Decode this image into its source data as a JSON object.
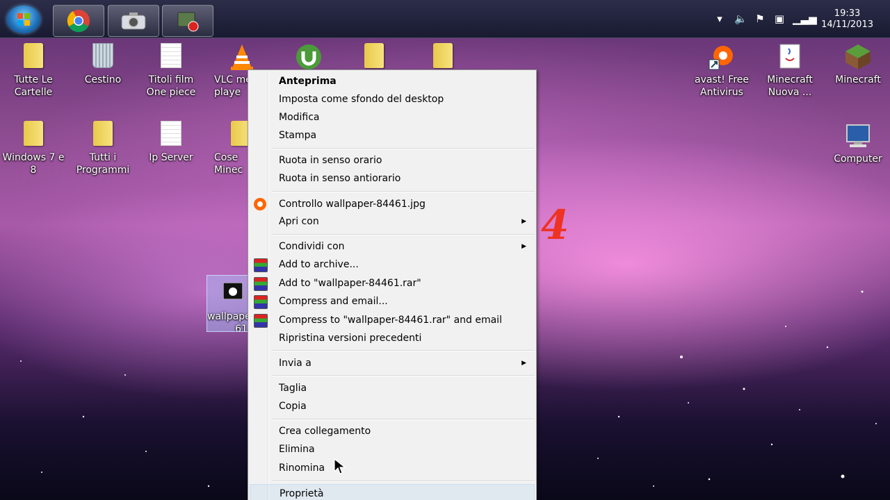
{
  "taskbar": {
    "buttons": [
      "chrome-icon",
      "camera-icon",
      "recorder-icon"
    ],
    "clock": {
      "time": "19:33",
      "date": "14/11/2013"
    }
  },
  "desktop": {
    "icons_left": [
      {
        "label": "Tutte Le Cartelle",
        "icon": "folder-icon"
      },
      {
        "label": "Cestino",
        "icon": "recycle-bin-icon"
      },
      {
        "label": "Titoli film One piece",
        "icon": "document-icon"
      },
      {
        "label": "VLC me playe",
        "icon": "vlc-icon"
      },
      {
        "label": "",
        "icon": "utorrent-icon"
      },
      {
        "label": "",
        "icon": "folder-icon"
      },
      {
        "label": "",
        "icon": "folder-icon"
      },
      {
        "label": "Windows 7 e 8",
        "icon": "folder-icon"
      },
      {
        "label": "Tutti i Programmi",
        "icon": "folder-icon"
      },
      {
        "label": "Ip Server",
        "icon": "document-icon"
      },
      {
        "label": "Cose Minec",
        "icon": "folder-icon"
      }
    ],
    "icons_right": [
      {
        "label": "avast! Free Antivirus",
        "icon": "avast-icon"
      },
      {
        "label": "Minecraft Nuova ...",
        "icon": "java-icon"
      },
      {
        "label": "Minecraft",
        "icon": "minecraft-icon"
      },
      {
        "label": "Computer",
        "icon": "computer-icon"
      }
    ],
    "selected_file": {
      "label_line1": "wallpape",
      "label_line2": "61",
      "icon": "apple-image-icon"
    }
  },
  "context_menu": {
    "items": [
      {
        "label": "Anteprima",
        "bold": true
      },
      {
        "label": "Imposta come sfondo del desktop"
      },
      {
        "label": "Modifica"
      },
      {
        "label": "Stampa"
      },
      {
        "label": "Ruota in senso orario"
      },
      {
        "label": "Ruota in senso antiorario"
      },
      {
        "label": "Controllo wallpaper-84461.jpg",
        "icon": "avast-icon"
      },
      {
        "label": "Apri con",
        "submenu": true
      },
      {
        "label": "Condividi con",
        "submenu": true
      },
      {
        "label": "Add to archive...",
        "icon": "winrar-icon"
      },
      {
        "label": "Add to \"wallpaper-84461.rar\"",
        "icon": "winrar-icon"
      },
      {
        "label": "Compress and email...",
        "icon": "winrar-icon"
      },
      {
        "label": "Compress to \"wallpaper-84461.rar\" and email",
        "icon": "winrar-icon"
      },
      {
        "label": "Ripristina versioni precedenti"
      },
      {
        "label": "Invia a",
        "submenu": true
      },
      {
        "label": "Taglia"
      },
      {
        "label": "Copia"
      },
      {
        "label": "Crea collegamento"
      },
      {
        "label": "Elimina"
      },
      {
        "label": "Rinomina"
      },
      {
        "label": "Proprietà"
      }
    ],
    "submenu_arrow": "▶"
  },
  "annotation": {
    "text": "4",
    "color": "#e32222"
  }
}
